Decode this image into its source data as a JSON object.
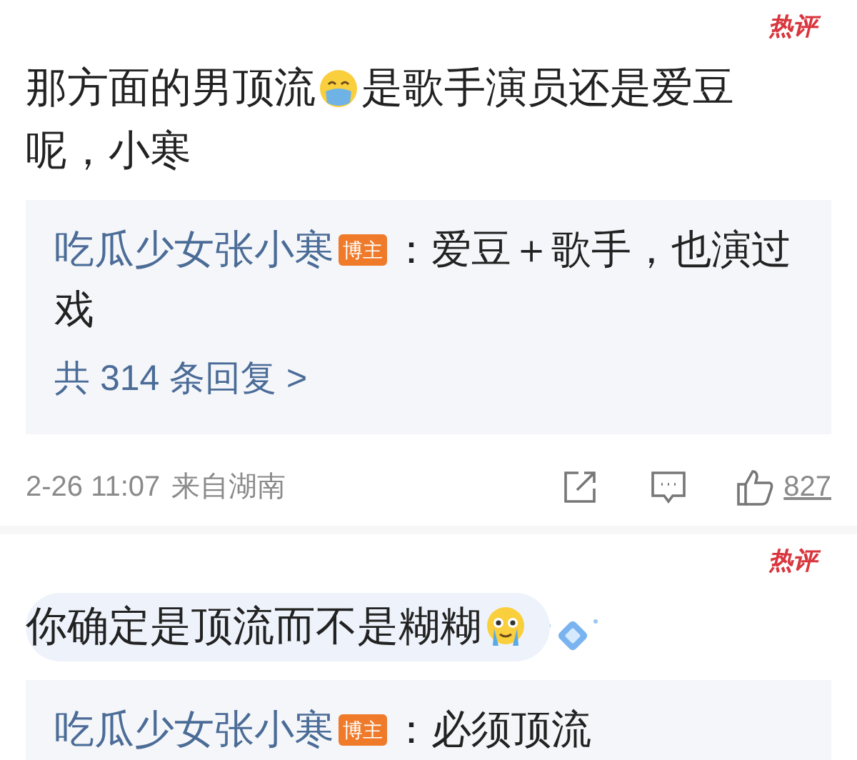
{
  "comments": [
    {
      "badge": "热评",
      "text_parts": [
        "那方面的男顶流",
        "是歌手演员还是爱豆",
        "呢，小寒"
      ],
      "emoji": {
        "kind": "mask"
      },
      "decorated": false,
      "replies": [
        {
          "author": "吃瓜少女张小寒",
          "author_badge": "博主",
          "text_parts": [
            "：爱豆＋歌手，也演过",
            "戏"
          ]
        }
      ],
      "reply_count": "共 314 条回复 >",
      "date": "2-26 11:07",
      "location": "来自湖南",
      "likes": "827"
    },
    {
      "badge": "热评",
      "text_parts": [
        "你确定是顶流而不是糊糊"
      ],
      "emoji": {
        "kind": "crying"
      },
      "decorated": true,
      "replies": [
        {
          "author": "吃瓜少女张小寒",
          "author_badge": "博主",
          "text_parts": [
            "：必须顶流"
          ]
        }
      ]
    }
  ]
}
